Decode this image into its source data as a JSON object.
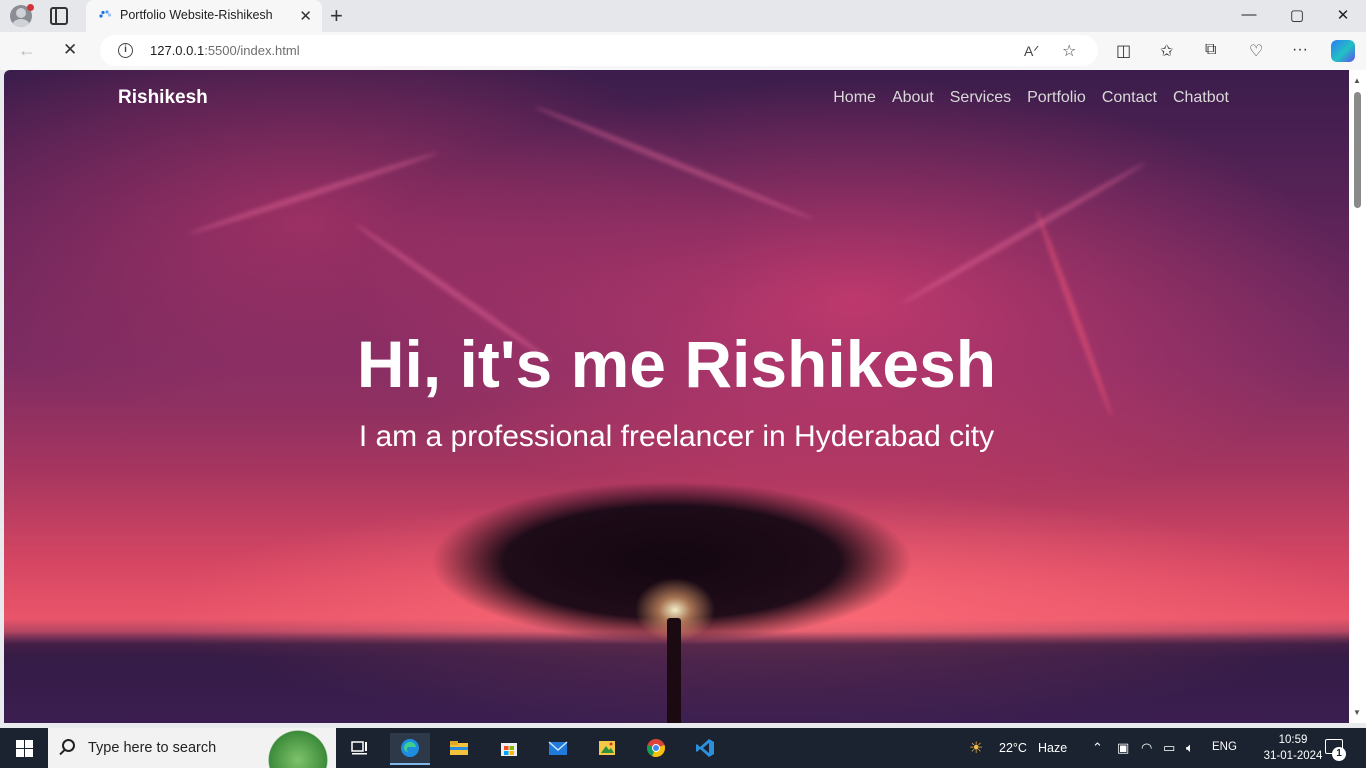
{
  "browser": {
    "tab": {
      "title": "Portfolio Website-Rishikesh",
      "close": "✕"
    },
    "new_tab": "+",
    "window": {
      "minimize": "—",
      "maximize": "▢",
      "close": "✕"
    },
    "url_host": "127.0.0.1",
    "url_rest": ":5500/index.html",
    "nav": {
      "back": "←",
      "stop": "✕"
    },
    "icons": [
      "read-aloud-icon",
      "favorite-star-icon",
      "split-screen-icon",
      "favorites-icon",
      "collections-icon",
      "browser-essentials-icon",
      "more-icon",
      "copilot-icon"
    ]
  },
  "page": {
    "logo": "Rishikesh",
    "nav_links": [
      "Home",
      "About",
      "Services",
      "Portfolio",
      "Contact",
      "Chatbot"
    ],
    "hero_title": "Hi, it's me Rishikesh",
    "hero_subtitle": "I am a professional freelancer in Hyderabad city"
  },
  "taskbar": {
    "search_placeholder": "Type here to search",
    "weather": "22°C",
    "weather_desc": "Haze",
    "language": "ENG",
    "time": "10:59",
    "date": "31-01-2024",
    "notification_count": "1",
    "apps": [
      "task-view",
      "edge",
      "file-explorer",
      "microsoft-store",
      "mail",
      "photos-app",
      "chrome",
      "vscode"
    ]
  },
  "colors": {
    "taskbar_bg": "#1b2330",
    "accent": "#7fb6ea"
  }
}
